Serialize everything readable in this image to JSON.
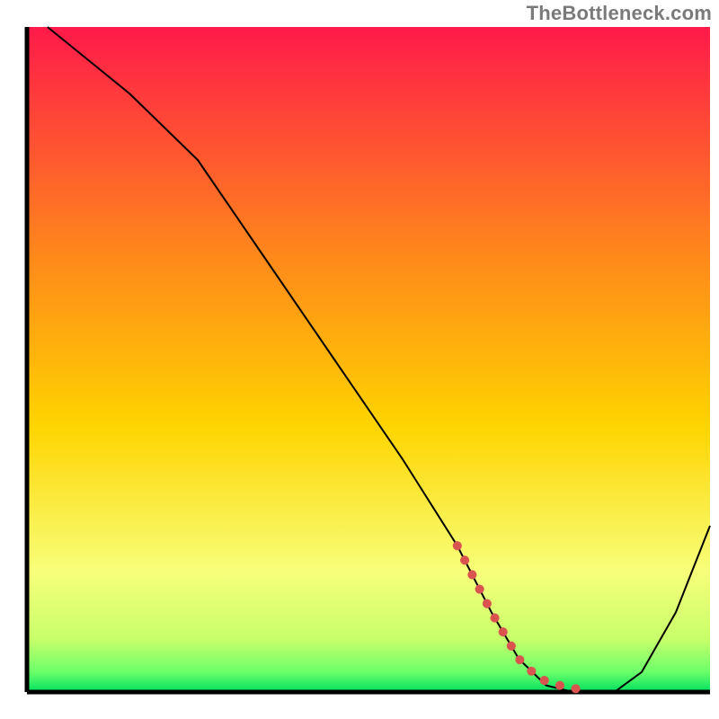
{
  "watermark": "TheBottleneck.com",
  "chart_data": {
    "type": "line",
    "title": "",
    "xlabel": "",
    "ylabel": "",
    "xlim": [
      0,
      100
    ],
    "ylim": [
      0,
      100
    ],
    "background_gradient_top": "#ff1a4a",
    "background_gradient_mid": "#ffd400",
    "background_gradient_low": "#f7ff7a",
    "background_gradient_bottom": "#00e060",
    "series": [
      {
        "name": "bottleneck-curve",
        "color": "#000000",
        "stroke_width": 2,
        "x": [
          3,
          15,
          25,
          35,
          45,
          55,
          63,
          68,
          72,
          76,
          80,
          82,
          86,
          90,
          95,
          100
        ],
        "y": [
          100,
          90,
          80,
          65,
          50,
          35,
          22,
          12,
          5,
          1,
          0,
          0,
          0,
          3,
          12,
          25
        ]
      },
      {
        "name": "highlight-segment",
        "color": "#d9534f",
        "stroke_width": 10,
        "dash": "0.1 18",
        "linecap": "round",
        "x": [
          63,
          68,
          72,
          75,
          78,
          80,
          82
        ],
        "y": [
          22,
          12,
          5,
          2,
          1,
          0.5,
          0.5
        ]
      }
    ]
  }
}
